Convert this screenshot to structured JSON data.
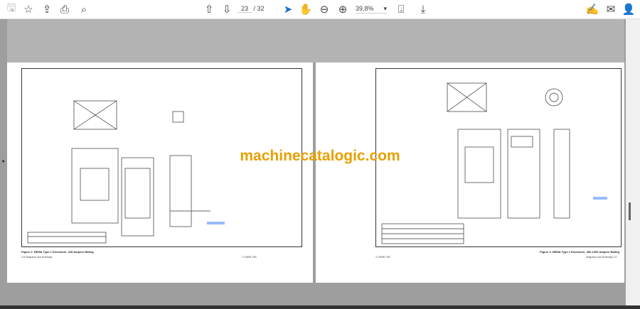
{
  "toolbar": {
    "icons": [
      "save-icon",
      "star-icon",
      "upload-icon",
      "print-icon",
      "search-icon",
      "page-up-icon",
      "page-down-icon",
      "select-arrow-icon",
      "hand-icon",
      "zoom-out-icon",
      "zoom-in-icon",
      "fit-page-icon",
      "scroll-mode-icon",
      "sign-icon",
      "mail-icon",
      "account-icon"
    ],
    "current_page": "23",
    "total_pages": "/ 32",
    "zoom": "39,8%"
  },
  "pages": [
    {
      "caption": "Figure 2. NEMA Type 1 Enclosure, 225 Ampere Rating",
      "footer_left": "2-8  Diagrams and Drawings",
      "footer_right": "71-9608  7/90"
    },
    {
      "caption": "Figure 3. NEMA Type 1 Enclosure, 400-1200 Ampere Rating",
      "footer_left": "71-9608  7/90",
      "footer_right": "Diagrams and Drawings  2-9"
    }
  ],
  "watermark": "machinecatalogic.com",
  "accent": "#1a6fd1"
}
